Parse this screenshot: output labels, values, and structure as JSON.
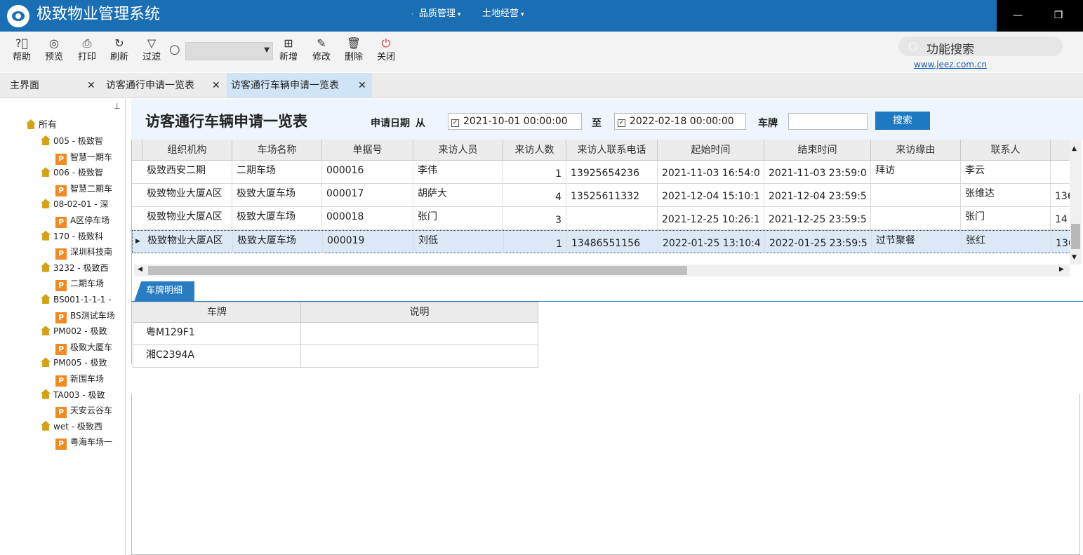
{
  "app": {
    "title": "极致物业管理系统",
    "menus": [
      "品质管理",
      "土地经营"
    ]
  },
  "window_controls": {
    "minimize": "—",
    "restore": "❐"
  },
  "toolbar": {
    "help": "帮助",
    "preview": "预览",
    "print": "打印",
    "refresh": "刷新",
    "filter": "过滤",
    "add": "新增",
    "edit": "修改",
    "delete": "删除",
    "close": "关闭",
    "combo_value": "",
    "func_search": "功能搜索",
    "website": "www.jeez.com.cn"
  },
  "tabs": [
    {
      "label": "主界面"
    },
    {
      "label": "访客通行申请一览表"
    },
    {
      "label": "访客通行车辆申请一览表"
    }
  ],
  "tree": {
    "root": "所有",
    "nodes": [
      {
        "type": "org",
        "label": "005 - 极致智"
      },
      {
        "type": "park",
        "label": "智慧一期车"
      },
      {
        "type": "org",
        "label": "006 - 极致智"
      },
      {
        "type": "park",
        "label": "智慧二期车"
      },
      {
        "type": "org",
        "label": "08-02-01 - 深"
      },
      {
        "type": "park",
        "label": "A区停车场"
      },
      {
        "type": "org",
        "label": "170 - 极致科"
      },
      {
        "type": "park",
        "label": "深圳科技南"
      },
      {
        "type": "org",
        "label": "3232 - 极致西"
      },
      {
        "type": "park",
        "label": "二期车场"
      },
      {
        "type": "org",
        "label": "BS001-1-1-1 -"
      },
      {
        "type": "park",
        "label": "BS测试车场"
      },
      {
        "type": "org",
        "label": "PM002 - 极致"
      },
      {
        "type": "park",
        "label": "极致大厦车"
      },
      {
        "type": "org",
        "label": "PM005 - 极致"
      },
      {
        "type": "park",
        "label": "新围车场"
      },
      {
        "type": "org",
        "label": "TA003 - 极致"
      },
      {
        "type": "park",
        "label": "天安云谷车"
      },
      {
        "type": "org",
        "label": "wet - 极致西"
      },
      {
        "type": "park",
        "label": "粤海车场一"
      }
    ]
  },
  "query": {
    "page_title": "访客通行车辆申请一览表",
    "date_label": "申请日期",
    "from_label": "从",
    "from_value": "2021-10-01 00:00:00",
    "to_label": "至",
    "to_value": "2022-02-18 00:00:00",
    "plate_label": "车牌",
    "plate_value": "",
    "search_button": "搜索"
  },
  "grid": {
    "columns": [
      "组织机构",
      "车场名称",
      "单据号",
      "来访人员",
      "来访人数",
      "来访人联系电话",
      "起始时间",
      "结束时间",
      "来访缘由",
      "联系人"
    ],
    "rows": [
      {
        "org": "极致西安二期",
        "park": "二期车场",
        "no": "000016",
        "visitor": "李伟",
        "count": "1",
        "phone": "13925654236",
        "start": "2021-11-03 16:54:0",
        "end": "2021-11-03 23:59:0",
        "reason": "拜访",
        "contact": "李云",
        "extra": ""
      },
      {
        "org": "极致物业大厦A区",
        "park": "极致大厦车场",
        "no": "000017",
        "visitor": "胡萨大",
        "count": "4",
        "phone": "13525611332",
        "start": "2021-12-04 15:10:1",
        "end": "2021-12-04 23:59:5",
        "reason": "",
        "contact": "张维达",
        "extra": "136"
      },
      {
        "org": "极致物业大厦A区",
        "park": "极致大厦车场",
        "no": "000018",
        "visitor": "张门",
        "count": "3",
        "phone": "",
        "start": "2021-12-25 10:26:1",
        "end": "2021-12-25 23:59:5",
        "reason": "",
        "contact": "张门",
        "extra": "14"
      },
      {
        "org": "极致物业大厦A区",
        "park": "极致大厦车场",
        "no": "000019",
        "visitor": "刘低",
        "count": "1",
        "phone": "13486551156",
        "start": "2022-01-25 13:10:4",
        "end": "2022-01-25 23:59:5",
        "reason": "过节聚餐",
        "contact": "张红",
        "extra": "136"
      }
    ]
  },
  "detail": {
    "tab": "车牌明细",
    "columns": [
      "车牌",
      "说明"
    ],
    "rows": [
      {
        "plate": "粤M129F1",
        "note": ""
      },
      {
        "plate": "湘C2394A",
        "note": ""
      }
    ]
  },
  "colors": {
    "titlebar": "#1a6fb4",
    "accent": "#1d79c2",
    "selected_row": "#dbe9f7"
  }
}
